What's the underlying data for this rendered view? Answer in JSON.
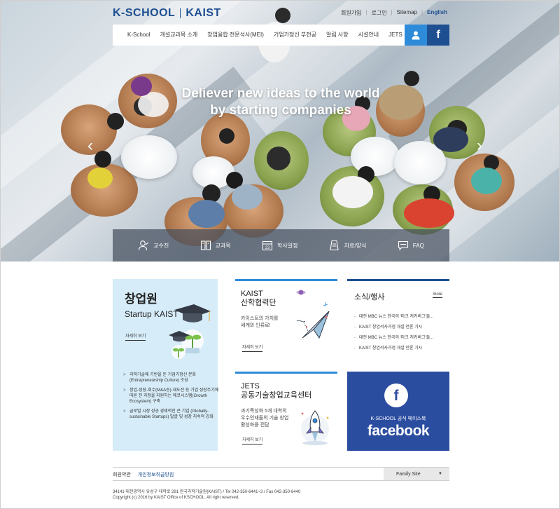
{
  "header": {
    "logo_left": "K-SCHOOL",
    "logo_right": "KAIST",
    "util_links": [
      "회원가입",
      "로그인",
      "Sitemap"
    ],
    "util_english": "English"
  },
  "nav": {
    "items": [
      "K-School",
      "개설교과목 소개",
      "창업융합 전문석사(MEI)",
      "기업가정신 부전공",
      "알림 사항",
      "시설안내",
      "JETS"
    ],
    "user_icon": "user-icon",
    "facebook_icon": "f"
  },
  "hero": {
    "line1": "Deliever new ideas to the world",
    "line2": "by starting companies",
    "prev_arrow": "‹",
    "next_arrow": "›"
  },
  "quick_menu": {
    "items": [
      {
        "label": "교수진",
        "icon": "professor-icon"
      },
      {
        "label": "교과목",
        "icon": "book-icon"
      },
      {
        "label": "학사일정",
        "icon": "calendar-icon"
      },
      {
        "label": "자료/양식",
        "icon": "document-icon"
      },
      {
        "label": "FAQ",
        "icon": "chat-icon"
      }
    ]
  },
  "startup": {
    "title": "창업원",
    "subtitle": "Startup KAIST",
    "more": "자세히 보기",
    "bullets": [
      "과학기술에 기반을 둔 기업가정신 문화(Entrepreneurship Culture) 조성",
      "창업-성장-회수(M&A등)-재도전 등 기업 성장주기에 따른 전 과정을 지원하는 에코시스템(Growth Ecosystem) 구축",
      "글로벌 시장 성공 경제적인 큰 기업 (Globally-sustainable Startups) 발굴 및 성장 지속적 강화"
    ]
  },
  "kaist_card": {
    "title_line1": "KAIST",
    "title_line2": "산학협력단",
    "desc_line1": "카이스트의 가치를",
    "desc_line2": "세계와 인류로!",
    "more": "자세히 보기"
  },
  "jets_card": {
    "title_line1": "JETS",
    "title_line2": "공동기술창업교육센터",
    "desc_line1": "과기특성화 5개 대학의",
    "desc_line2": "우수인재들의 기술 창업",
    "desc_line3": "활성화를 전담",
    "more": "자세히 보기"
  },
  "news": {
    "title": "소식/행사",
    "more": "more",
    "items": [
      "대전 MBC 뉴스 한국의 '마크 저커버그'들...",
      "KAIST 창업석사과정 개설 언론 기사",
      "대전 MBC 뉴스 한국의 '마크 저커버그'들...",
      "KAIST 창업석사과정 개설 언론 기사"
    ]
  },
  "facebook_box": {
    "letter": "f",
    "label": "K-SCHOOL 공식 페이스북",
    "word": "facebook"
  },
  "footer": {
    "terms": "회원약관",
    "privacy": "개인정보취급방침",
    "family_site": "Family Site",
    "family_arrow": "▼",
    "address": "34141 대전광역시 유성구 대학로 291 한국과학기술원(KAIST) / Tel 042-350-6441~3 / Fax 042-350-6440",
    "copyright": "Copyright (c) 2016 by KAIST Office of KSCHOOL. All right reserved."
  },
  "colors": {
    "brand_navy": "#1d4f91",
    "accent_blue": "#2e8bd9",
    "facebook_blue": "#2b4da0",
    "startup_bg": "#d6ecf8"
  }
}
